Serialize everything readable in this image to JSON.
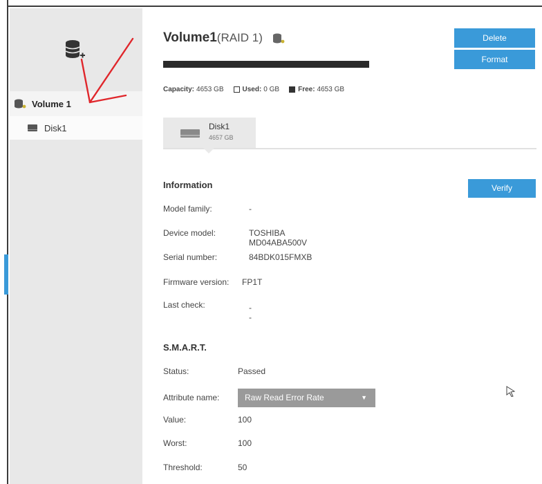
{
  "sidebar": {
    "volume_label": "Volume 1",
    "disk_label": "Disk1"
  },
  "volume": {
    "title": "Volume1",
    "raid": "(RAID 1)",
    "capacity_label": "Capacity:",
    "capacity_value": "4653 GB",
    "used_label": "Used:",
    "used_value": "0 GB",
    "free_label": "Free:",
    "free_value": "4653 GB",
    "used_fraction": 0.0
  },
  "buttons": {
    "delete": "Delete",
    "format": "Format",
    "verify": "Verify"
  },
  "disk_tab": {
    "name": "Disk1",
    "size": "4657 GB"
  },
  "information": {
    "title": "Information",
    "rows": [
      {
        "label": "Model family:",
        "value": "-"
      },
      {
        "label": "Device model:",
        "value": "TOSHIBA MD04ABA500V"
      },
      {
        "label": "Serial number:",
        "value": "84BDK015FMXB"
      },
      {
        "label": "Firmware version:",
        "value": "FP1T"
      },
      {
        "label": "Last check:",
        "value": "- -"
      }
    ]
  },
  "smart": {
    "title": "S.M.A.R.T.",
    "status_label": "Status:",
    "status_value": "Passed",
    "attribute_label": "Attribute name:",
    "attribute_selected": "Raw Read Error Rate",
    "value_label": "Value:",
    "value_value": "100",
    "worst_label": "Worst:",
    "worst_value": "100",
    "threshold_label": "Threshold:",
    "threshold_value": "50"
  },
  "colors": {
    "accent": "#3a9ad9",
    "annotation_arrow": "#e0262b"
  },
  "icons": [
    "database-add-icon",
    "volume-icon",
    "disk-icon",
    "cursor-icon",
    "chevron-down-icon"
  ]
}
